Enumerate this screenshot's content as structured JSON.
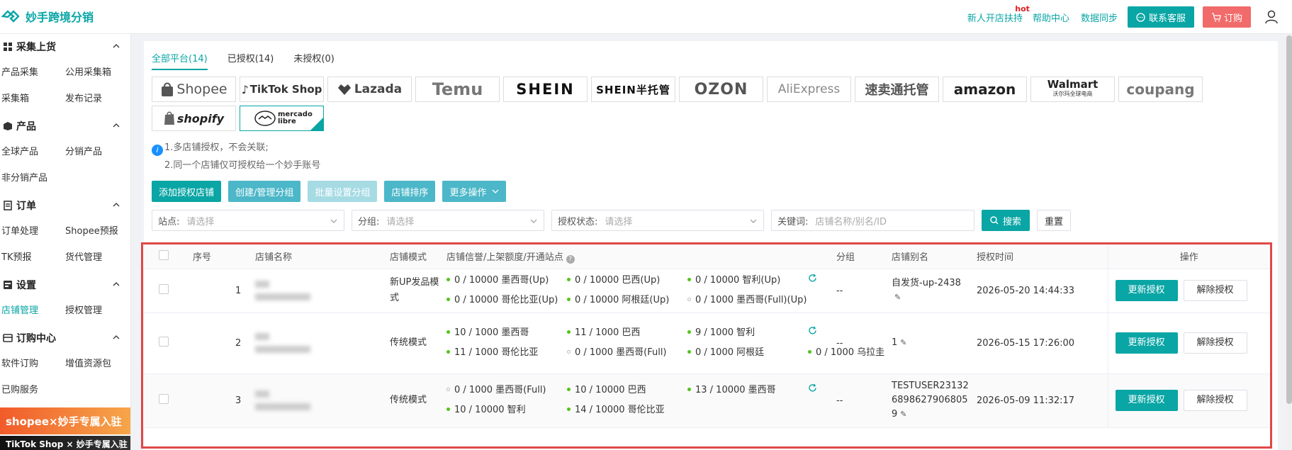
{
  "app": {
    "name": "妙手跨境分销"
  },
  "header": {
    "new_store": "新人开店扶持",
    "hot": "hot",
    "help": "帮助中心",
    "sync": "数据同步",
    "contact": "联系客服",
    "order": "订购"
  },
  "sidebar": {
    "groups": [
      {
        "title": "采集上货",
        "icon": "grid-icon",
        "items": [
          "产品采集",
          "公用采集箱",
          "采集箱",
          "发布记录"
        ]
      },
      {
        "title": "产品",
        "icon": "box-icon",
        "items": [
          "全球产品",
          "分销产品",
          "非分销产品"
        ]
      },
      {
        "title": "订单",
        "icon": "document-icon",
        "items": [
          "订单处理",
          "Shopee预报",
          "TK预报",
          "货代管理"
        ]
      },
      {
        "title": "设置",
        "icon": "settings-icon",
        "items": [
          "店铺管理",
          "授权管理"
        ],
        "active": "店铺管理"
      },
      {
        "title": "订购中心",
        "icon": "card-icon",
        "items": [
          "软件订购",
          "增值资源包",
          "已购服务"
        ]
      }
    ],
    "banner1": "shopee×妙手专属入驻",
    "banner2": "TikTok Shop × 妙手专属入驻"
  },
  "tabs": [
    "全部平台(14)",
    "已授权(14)",
    "未授权(0)"
  ],
  "platforms": [
    "Shopee",
    "TikTok Shop",
    "Lazada",
    "Temu",
    "SHEIN",
    "SHEIN半托管",
    "OZON",
    "AliExpress",
    "速卖通托管",
    "amazon",
    "Walmart",
    "coupang",
    "shopify",
    "mercado libre"
  ],
  "walmart_sub": "沃尔玛全球电商",
  "tips": [
    "1.多店铺授权，不会关联;",
    "2.同一个店铺仅可授权给一个妙手账号"
  ],
  "actions": [
    "添加授权店铺",
    "创建/管理分组",
    "批量设置分组",
    "店铺排序",
    "更多操作"
  ],
  "filters": {
    "site_label": "站点:",
    "site_ph": "请选择",
    "group_label": "分组:",
    "group_ph": "请选择",
    "auth_label": "授权状态:",
    "auth_ph": "请选择",
    "keyword_label": "关键词:",
    "keyword_ph": "店铺名称/别名/ID",
    "search": "搜索",
    "reset": "重置"
  },
  "table": {
    "headers": [
      "序号",
      "店铺名称",
      "店铺模式",
      "店铺信誉/上架额度/开通站点",
      "分组",
      "店铺别名",
      "授权时间",
      "操作"
    ],
    "update_label": "更新授权",
    "release_label": "解除授权",
    "rows": [
      {
        "no": "1",
        "mode": "新UP发品模式",
        "sites": [
          {
            "t": "0 / 10000 墨西哥(Up)",
            "on": true
          },
          {
            "t": "0 / 10000 巴西(Up)",
            "on": true
          },
          {
            "t": "0 / 10000 智利(Up)",
            "on": true
          },
          {
            "t": "0 / 10000 哥伦比亚(Up)",
            "on": true
          },
          {
            "t": "0 / 10000 阿根廷(Up)",
            "on": true
          },
          {
            "t": "0 / 1000 墨西哥(Full)(Up)",
            "on": false
          }
        ],
        "group": "--",
        "alias": "自发货-up-2438",
        "time": "2026-05-20 14:44:33"
      },
      {
        "no": "2",
        "mode": "传统模式",
        "sites": [
          {
            "t": "10 / 1000 墨西哥",
            "on": true
          },
          {
            "t": "11 / 1000 巴西",
            "on": true
          },
          {
            "t": "9 / 1000 智利",
            "on": true
          },
          {
            "t": "11 / 1000 哥伦比亚",
            "on": true
          },
          {
            "t": "0 / 1000 墨西哥(Full)",
            "on": false
          },
          {
            "t": "0 / 1000 阿根廷",
            "on": true
          },
          {
            "t": "0 / 1000 乌拉圭",
            "on": true
          }
        ],
        "group": "--",
        "alias": "1",
        "time": "2026-05-15 17:26:00"
      },
      {
        "no": "3",
        "mode": "传统模式",
        "sites": [
          {
            "t": "0 / 1000 墨西哥(Full)",
            "on": false
          },
          {
            "t": "10 / 10000 巴西",
            "on": true
          },
          {
            "t": "13 / 10000 墨西哥",
            "on": true
          },
          {
            "t": "10 / 10000 智利",
            "on": true
          },
          {
            "t": "14 / 10000 哥伦比亚",
            "on": true
          }
        ],
        "group": "--",
        "alias": "TESTUSER2313268986279068059",
        "time": "2026-05-09 11:32:17"
      }
    ]
  }
}
